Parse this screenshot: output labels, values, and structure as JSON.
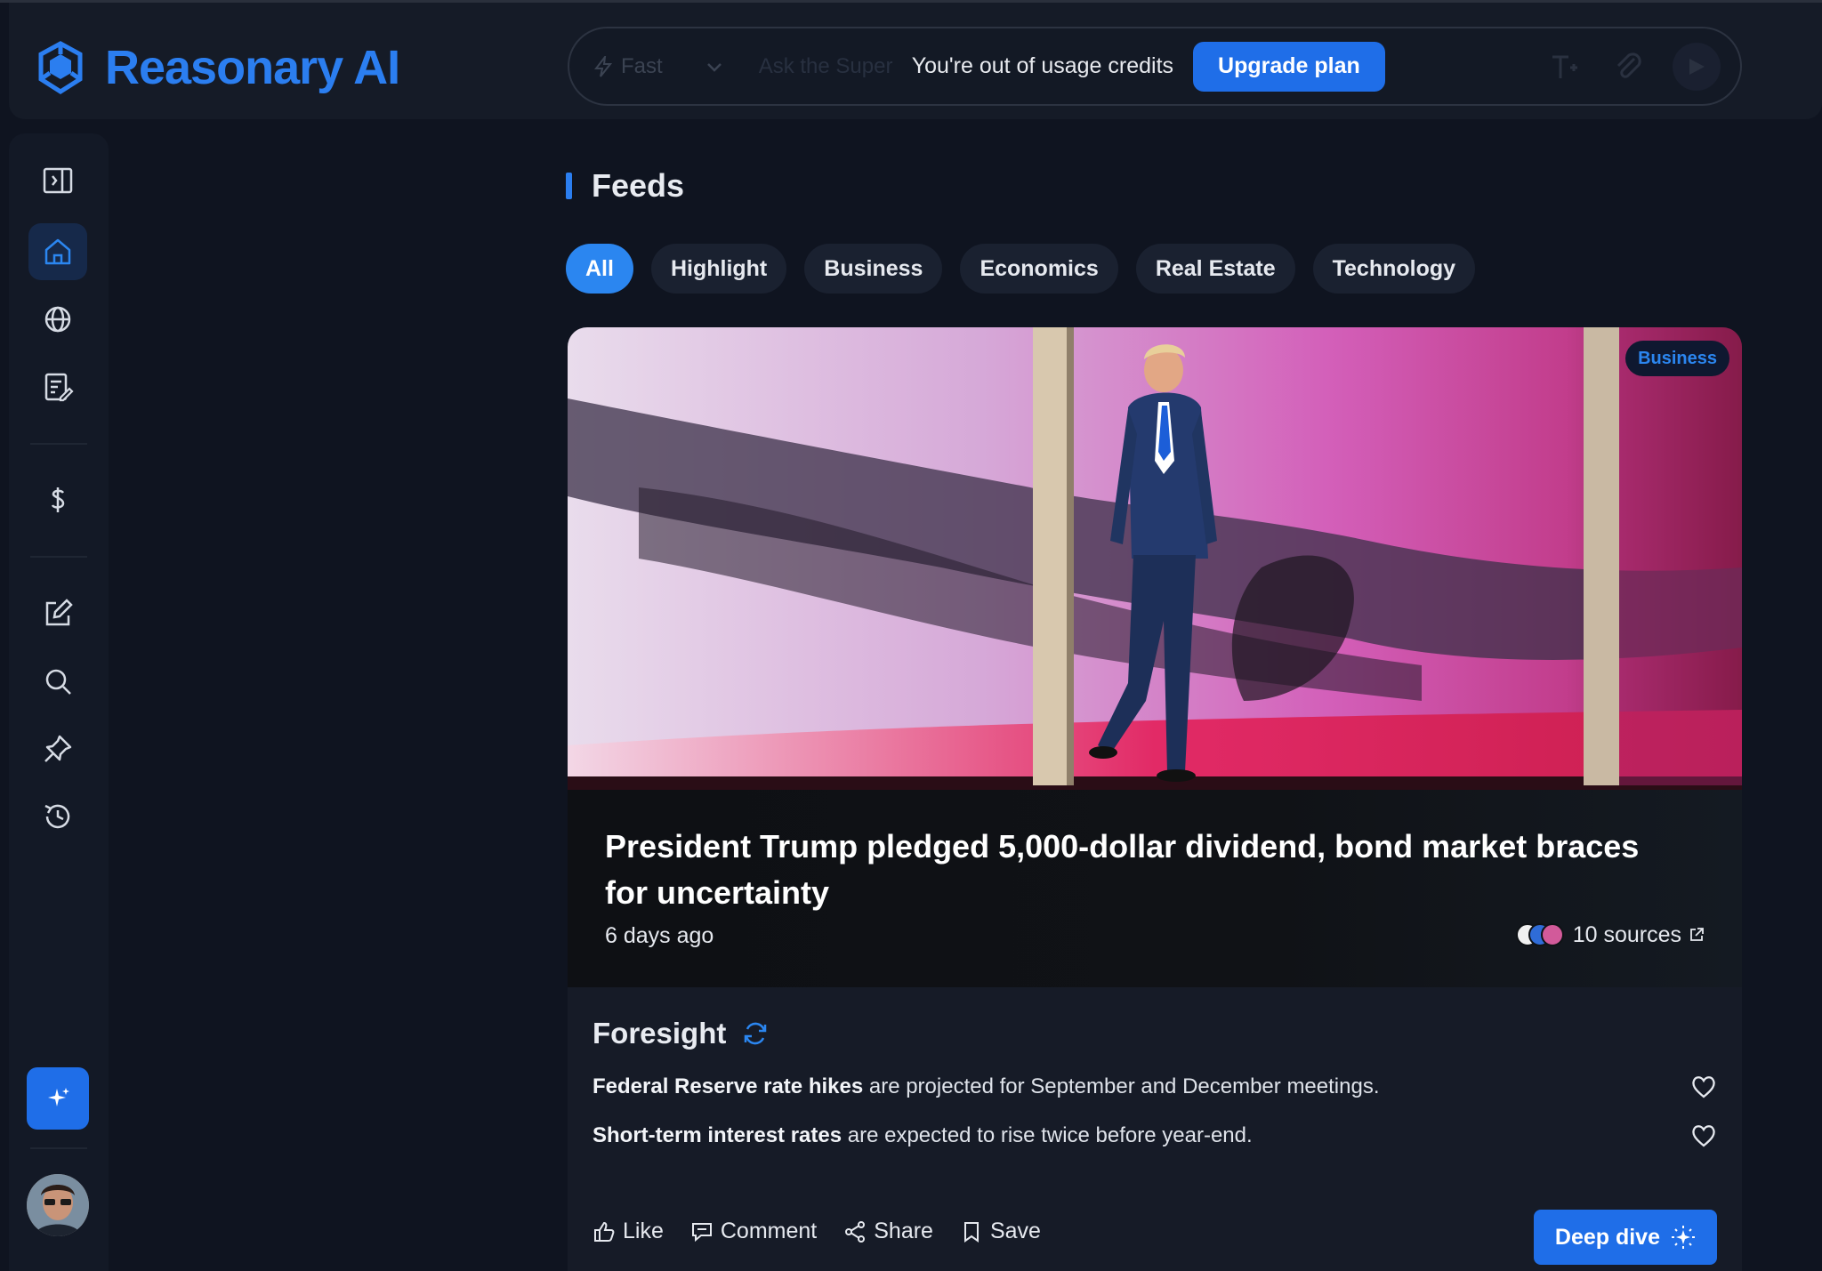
{
  "app": {
    "name": "Reasonary AI",
    "brand_color": "#2b7ef0"
  },
  "topbar": {
    "mode_label": "Fast",
    "input_placeholder": "Ask the Super",
    "credits_message": "You're out of usage credits",
    "upgrade_label": "Upgrade plan"
  },
  "sidebar": {
    "items": [
      {
        "name": "toggle-panel",
        "icon": "sidebar-toggle-icon"
      },
      {
        "name": "home",
        "icon": "home-icon",
        "active": true
      },
      {
        "name": "discover",
        "icon": "globe-icon"
      },
      {
        "name": "library",
        "icon": "document-edit-icon"
      },
      {
        "name": "pricing",
        "icon": "dollar-icon"
      },
      {
        "name": "new-chat",
        "icon": "compose-icon"
      },
      {
        "name": "search",
        "icon": "search-icon"
      },
      {
        "name": "pinned",
        "icon": "pin-icon"
      },
      {
        "name": "history",
        "icon": "history-icon"
      }
    ]
  },
  "feeds": {
    "title": "Feeds",
    "tabs": [
      "All",
      "Highlight",
      "Business",
      "Economics",
      "Real Estate",
      "Technology"
    ],
    "active_tab": "All"
  },
  "article": {
    "category": "Business",
    "headline": "President Trump pledged 5,000-dollar dividend, bond market braces for uncertainty",
    "age": "6 days ago",
    "sources_label": "10 sources",
    "foresight_title": "Foresight",
    "foresight_items": [
      {
        "bold": "Federal Reserve rate hikes",
        "rest": " are projected for September and December meetings."
      },
      {
        "bold": "Short-term interest rates",
        "rest": " are expected to rise twice before year-end."
      }
    ],
    "actions": {
      "like": "Like",
      "comment": "Comment",
      "share": "Share",
      "save": "Save"
    },
    "deep_dive_label": "Deep dive"
  }
}
